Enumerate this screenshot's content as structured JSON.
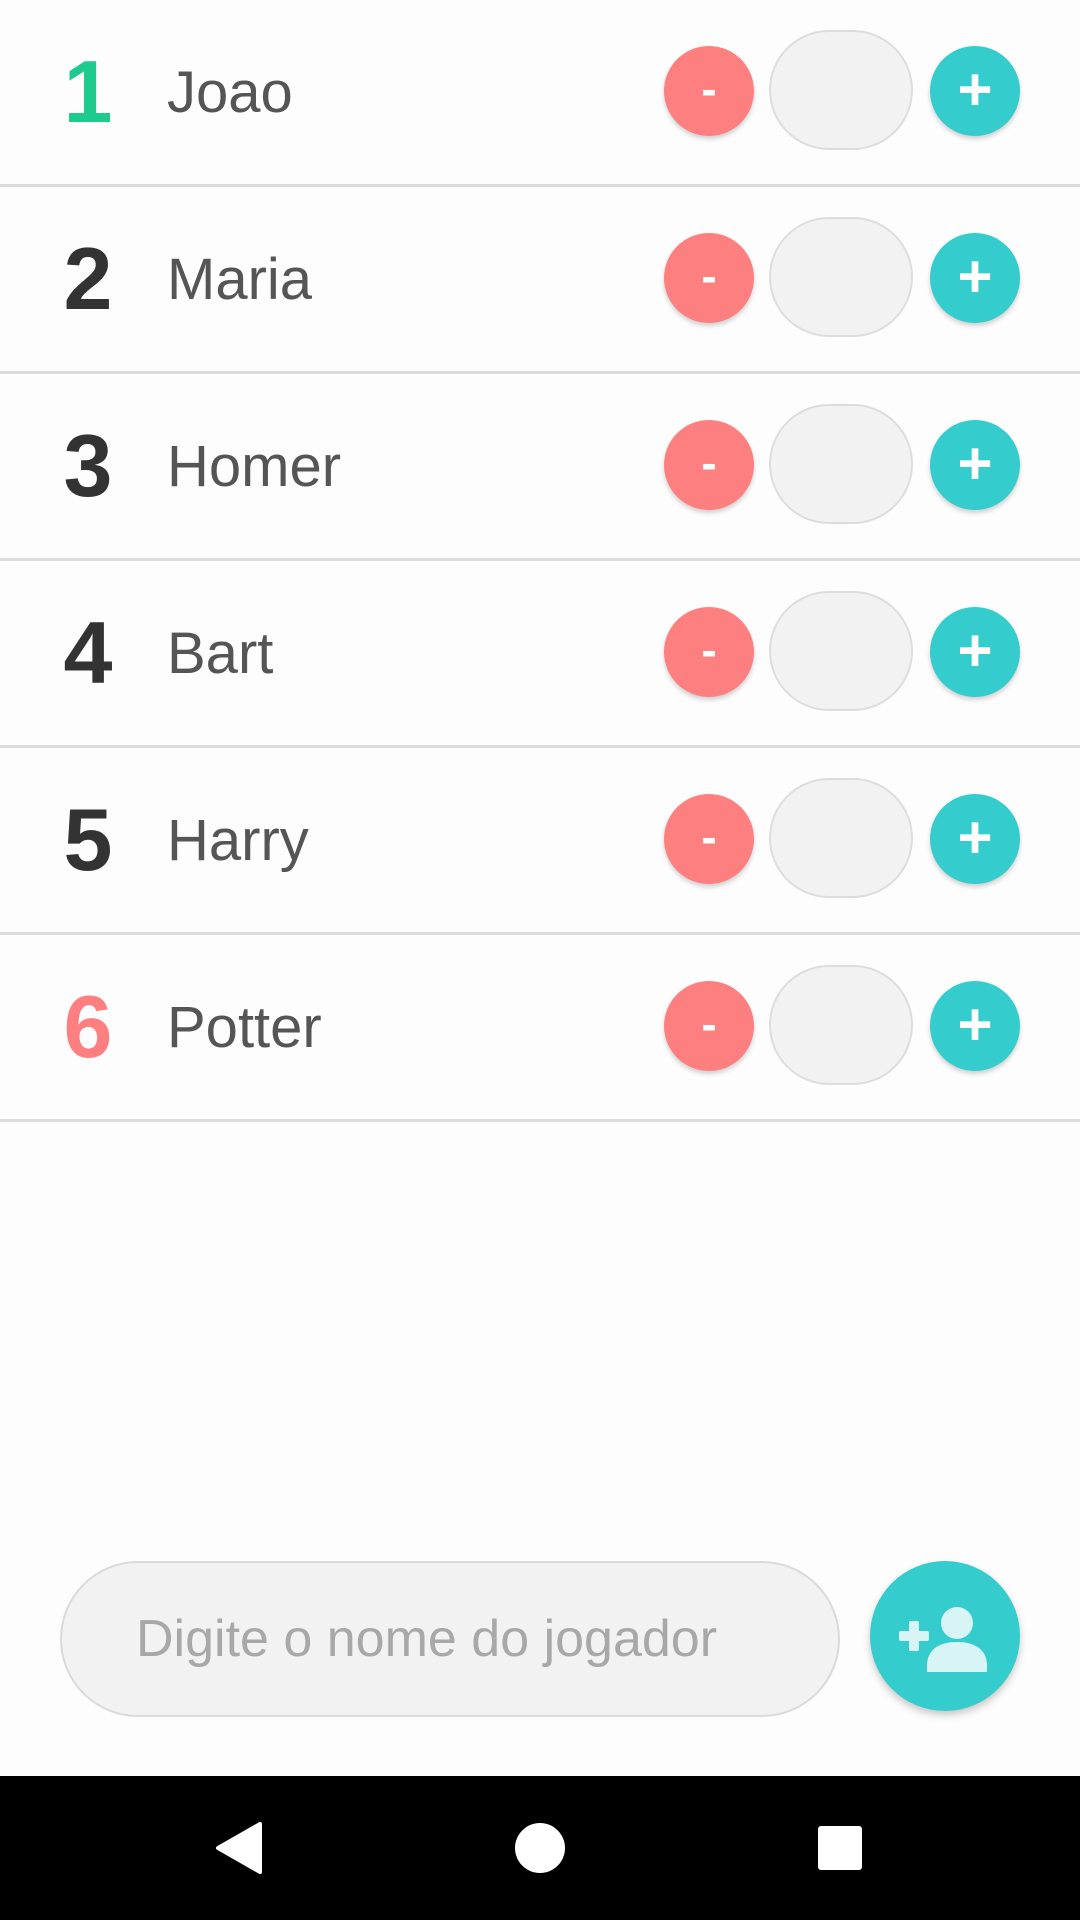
{
  "players": [
    {
      "rank": "1",
      "name": "Joao",
      "score": "",
      "minus_label": "-",
      "plus_label": "+",
      "rank_color": "#1ccb8d"
    },
    {
      "rank": "2",
      "name": "Maria",
      "score": "",
      "minus_label": "-",
      "plus_label": "+",
      "rank_color": "#333333"
    },
    {
      "rank": "3",
      "name": "Homer",
      "score": "",
      "minus_label": "-",
      "plus_label": "+",
      "rank_color": "#333333"
    },
    {
      "rank": "4",
      "name": "Bart",
      "score": "",
      "minus_label": "-",
      "plus_label": "+",
      "rank_color": "#333333"
    },
    {
      "rank": "5",
      "name": "Harry",
      "score": "",
      "minus_label": "-",
      "plus_label": "+",
      "rank_color": "#333333"
    },
    {
      "rank": "6",
      "name": "Potter",
      "score": "",
      "minus_label": "-",
      "plus_label": "+",
      "rank_color": "#fe7f7f"
    }
  ],
  "new_player": {
    "placeholder": "Digite o nome do jogador",
    "value": "",
    "add_icon": "person-add-icon"
  },
  "nav_bar": {
    "back_icon": "back-triangle-icon",
    "home_icon": "home-circle-icon",
    "recents_icon": "recents-square-icon"
  },
  "colors": {
    "minus_button": "#fe7f7f",
    "plus_button": "#34cccc",
    "first_place": "#1ccb8d",
    "last_place": "#fe7f7f",
    "rank_default": "#333333",
    "name_text": "#555555",
    "score_box": "#f2f2f2",
    "nav_bar": "#000000"
  }
}
